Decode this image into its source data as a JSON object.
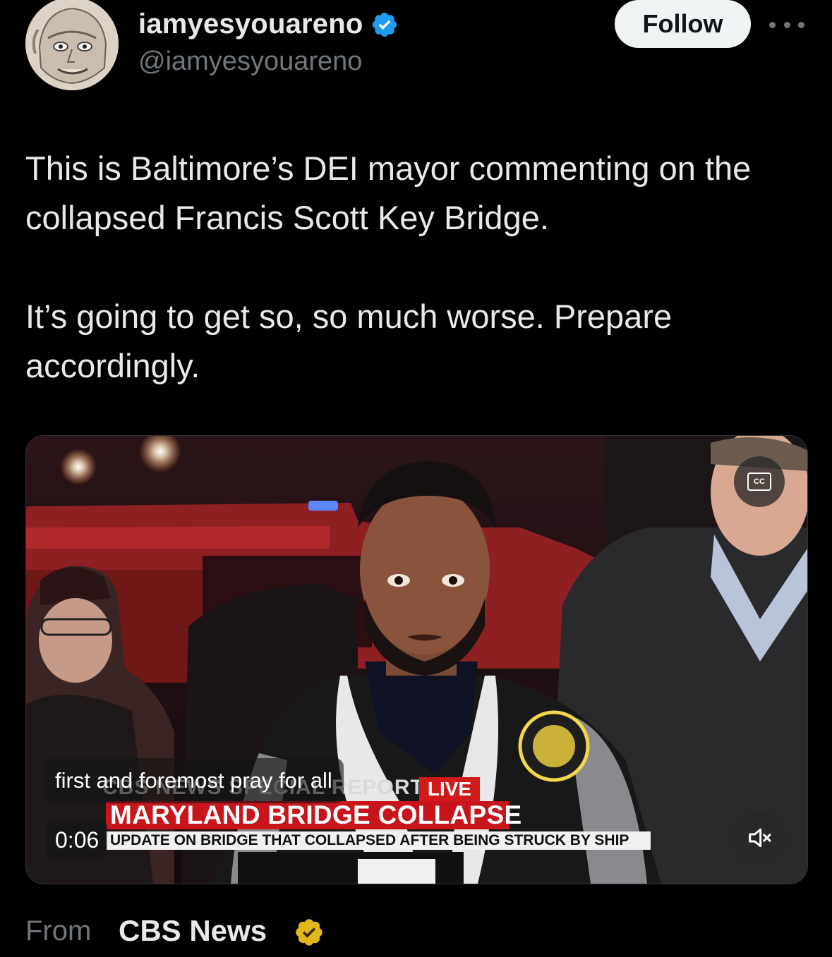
{
  "author": {
    "display_name": "iamyesyouareno",
    "handle": "@iamyesyouareno",
    "verified": true
  },
  "actions": {
    "follow_label": "Follow"
  },
  "tweet": {
    "paragraphs": [
      "This is Baltimore’s DEI mayor commenting on the collapsed Francis Scott Key Bridge.",
      "It’s going to get so, so much worse. Prepare accordingly."
    ]
  },
  "video": {
    "caption": "first and foremost pray for all",
    "timestamp": "0:06",
    "cc_label": "CC",
    "broadcast": {
      "report_label": "CBS NEWS SPECIAL REPORT",
      "live_label": "LIVE",
      "headline": "MARYLAND BRIDGE COLLAPSE",
      "subheadline": "UPDATE ON BRIDGE THAT COLLAPSED AFTER BEING STRUCK BY SHIP"
    }
  },
  "source": {
    "from_label": "From",
    "name": "CBS News",
    "badge": "gold-verified"
  },
  "colors": {
    "background": "#000000",
    "text_primary": "#e7e9ea",
    "text_secondary": "#71767b",
    "verified_blue": "#1d9bf0",
    "verified_gold": "#e2b719",
    "follow_bg": "#eff3f4",
    "broadcast_red": "#c8151b"
  }
}
